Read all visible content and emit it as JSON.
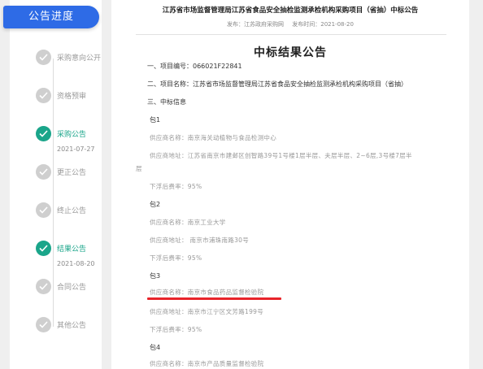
{
  "sidebar": {
    "title": "公告进度",
    "steps": [
      {
        "label": "采购意向公开",
        "date": "",
        "active": false
      },
      {
        "label": "资格预审",
        "date": "",
        "active": false
      },
      {
        "label": "采购公告",
        "date": "2021-07-27",
        "active": true
      },
      {
        "label": "更正公告",
        "date": "",
        "active": false
      },
      {
        "label": "终止公告",
        "date": "",
        "active": false
      },
      {
        "label": "结果公告",
        "date": "2021-08-20",
        "active": true
      },
      {
        "label": "合同公告",
        "date": "",
        "active": false
      },
      {
        "label": "其他公告",
        "date": "",
        "active": false
      }
    ]
  },
  "doc": {
    "title": "江苏省市场监督管理局江苏省食品安全抽检监测承检机构采购项目（省抽）中标公告",
    "source": "发布：江苏政府采购网",
    "publish_time": "发布时间：2021-08-20",
    "heading": "中标结果公告",
    "item1": "一、项目编号：066021F22841",
    "item2": "二、项目名称：江苏省市场监督管理局江苏省食品安全抽检监测承检机构采购项目（省抽）",
    "item3": "三、中标信息",
    "packages": [
      {
        "name": "包1",
        "supplier": "供应商名称：南京海关动植物与食品检测中心",
        "address_line1": "供应商地址：江苏省南京市建邺区创智路39号1号楼1层半层、夫层半层、2~6层,3号楼7层半",
        "address_line2": "层",
        "rate": "下浮后费率：95%"
      },
      {
        "name": "包2",
        "supplier": "供应商名称：南京工业大学",
        "address_line1": "供应商地址： 南京市浦珠南路30号",
        "rate": "下浮后费率：95%"
      },
      {
        "name": "包3",
        "supplier": "供应商名称：南京市食品药品监督检验院",
        "address_line1": "供应商地址：南京市江宁区文芳路199号",
        "rate": "下浮后费率：95%"
      },
      {
        "name": "包4",
        "supplier": "供应商名称：南京市产品质量监督检验院"
      }
    ]
  },
  "colors": {
    "accent": "#2e6be6",
    "active_step": "#1aa58a",
    "highlight": "#e8242a"
  }
}
